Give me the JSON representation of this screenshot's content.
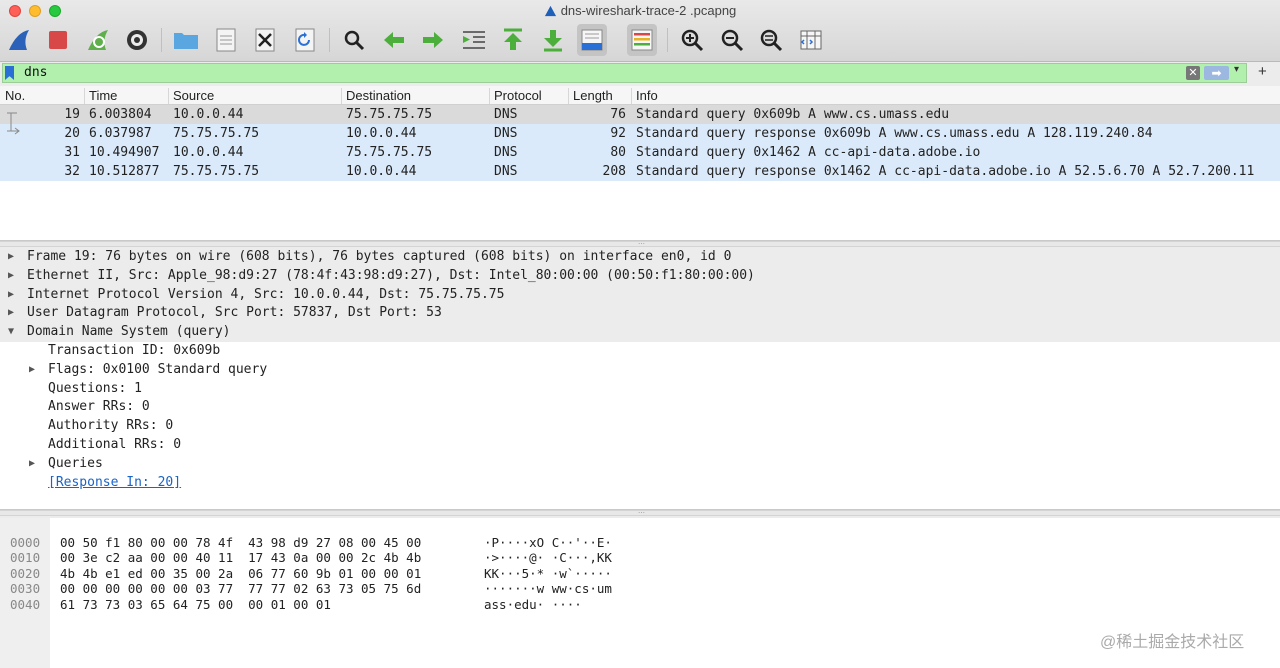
{
  "window": {
    "title": "dns-wireshark-trace-2 .pcapng"
  },
  "toolbar": {
    "buttons": [
      {
        "name": "start-capture-icon"
      },
      {
        "name": "stop-capture-icon"
      },
      {
        "name": "restart-capture-icon"
      },
      {
        "name": "capture-options-icon"
      },
      {
        "name": "open-file-icon"
      },
      {
        "name": "save-file-icon"
      },
      {
        "name": "close-file-icon"
      },
      {
        "name": "reload-file-icon"
      },
      {
        "name": "find-packet-icon"
      },
      {
        "name": "go-back-icon"
      },
      {
        "name": "go-forward-icon"
      },
      {
        "name": "go-to-packet-icon"
      },
      {
        "name": "go-first-packet-icon"
      },
      {
        "name": "go-last-packet-icon"
      },
      {
        "name": "autoscroll-icon"
      },
      {
        "name": "colorize-icon"
      },
      {
        "name": "zoom-in-icon"
      },
      {
        "name": "zoom-out-icon"
      },
      {
        "name": "normal-size-icon"
      },
      {
        "name": "resize-columns-icon"
      }
    ]
  },
  "filter": {
    "value": "dns",
    "clear_glyph": "✕",
    "apply_glyph": "➡",
    "dropdown_glyph": "▾",
    "add_glyph": "+"
  },
  "packet_list": {
    "columns": [
      "No.",
      "Time",
      "Source",
      "Destination",
      "Protocol",
      "Length",
      "Info"
    ],
    "rows": [
      {
        "no": "19",
        "time": "6.003804",
        "source": "10.0.0.44",
        "destination": "75.75.75.75",
        "protocol": "DNS",
        "length": "76",
        "info": "Standard query 0x609b A www.cs.umass.edu"
      },
      {
        "no": "20",
        "time": "6.037987",
        "source": "75.75.75.75",
        "destination": "10.0.0.44",
        "protocol": "DNS",
        "length": "92",
        "info": "Standard query response 0x609b A www.cs.umass.edu A 128.119.240.84"
      },
      {
        "no": "31",
        "time": "10.494907",
        "source": "10.0.0.44",
        "destination": "75.75.75.75",
        "protocol": "DNS",
        "length": "80",
        "info": "Standard query 0x1462 A cc-api-data.adobe.io"
      },
      {
        "no": "32",
        "time": "10.512877",
        "source": "75.75.75.75",
        "destination": "10.0.0.44",
        "protocol": "DNS",
        "length": "208",
        "info": "Standard query response 0x1462 A cc-api-data.adobe.io A 52.5.6.70 A 52.7.200.11"
      }
    ]
  },
  "details": {
    "frame": "Frame 19: 76 bytes on wire (608 bits), 76 bytes captured (608 bits) on interface en0, id 0",
    "ethernet": "Ethernet II, Src: Apple_98:d9:27 (78:4f:43:98:d9:27), Dst: Intel_80:00:00 (00:50:f1:80:00:00)",
    "ip": "Internet Protocol Version 4, Src: 10.0.0.44, Dst: 75.75.75.75",
    "udp": "User Datagram Protocol, Src Port: 57837, Dst Port: 53",
    "dns": "Domain Name System (query)",
    "transaction_id": "Transaction ID: 0x609b",
    "flags": "Flags: 0x0100 Standard query",
    "questions": "Questions: 1",
    "answer_rrs": "Answer RRs: 0",
    "authority_rrs": "Authority RRs: 0",
    "additional_rrs": "Additional RRs: 0",
    "queries": "Queries",
    "response_in": "[Response In: 20]"
  },
  "bytes": {
    "rows": [
      {
        "offset": "0000",
        "hex": "00 50 f1 80 00 00 78 4f  43 98 d9 27 08 00 45 00",
        "ascii": "·P····xO C··'··E·"
      },
      {
        "offset": "0010",
        "hex": "00 3e c2 aa 00 00 40 11  17 43 0a 00 00 2c 4b 4b",
        "ascii": "·>····@· ·C···,KK"
      },
      {
        "offset": "0020",
        "hex": "4b 4b e1 ed 00 35 00 2a  06 77 60 9b 01 00 00 01",
        "ascii": "KK···5·* ·w`·····"
      },
      {
        "offset": "0030",
        "hex": "00 00 00 00 00 00 03 77  77 77 02 63 73 05 75 6d",
        "ascii": "·······w ww·cs·um"
      },
      {
        "offset": "0040",
        "hex": "61 73 73 03 65 64 75 00  00 01 00 01",
        "ascii": "ass·edu· ····"
      }
    ]
  },
  "watermark": "@稀土掘金技术社区"
}
